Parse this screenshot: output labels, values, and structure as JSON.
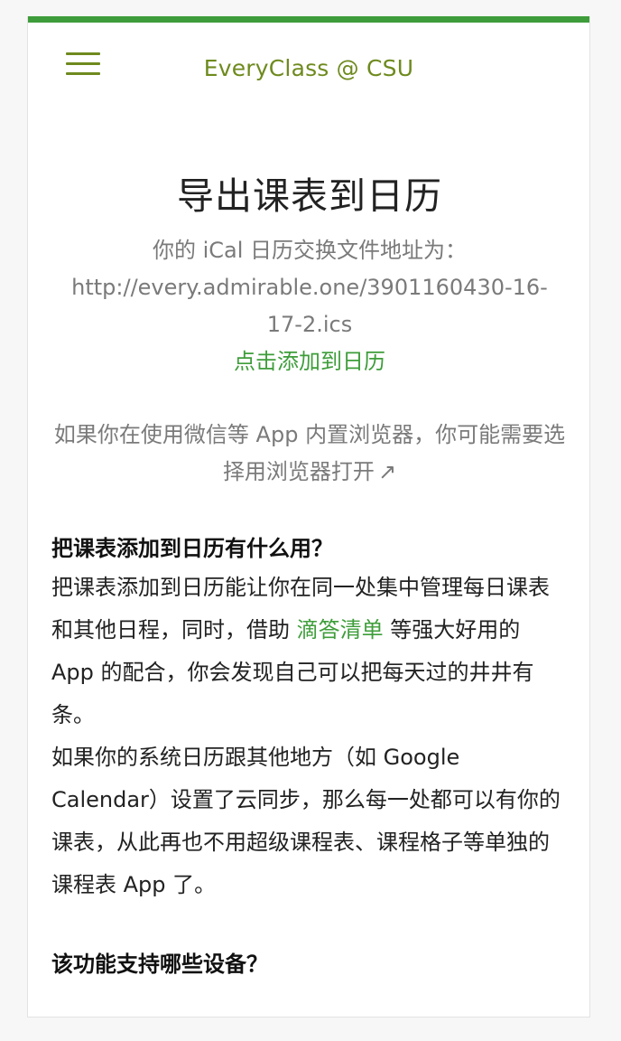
{
  "colors": {
    "accent": "#3e9d3a",
    "brand": "#6e8a1e",
    "muted_text": "#7a7a7a",
    "body_text": "#222222"
  },
  "navbar": {
    "menu_icon": "hamburger-menu-icon",
    "brand": "EveryClass @ CSU"
  },
  "export": {
    "title": "导出课表到日历",
    "address_label": "你的 iCal 日历交换文件地址为：",
    "ical_url": "http://every.admirable.one/3901160430-16-17-2.ics",
    "add_link": "点击添加到日历",
    "browser_note": "如果你在使用微信等 App 内置浏览器，你可能需要选择用浏览器打开",
    "browser_note_icon": "↗"
  },
  "faq": {
    "q1_title": "把课表添加到日历有什么用？",
    "q1_text_before": "把课表添加到日历能让你在同一处集中管理每日课表和其他日程，同时，借助 ",
    "q1_link": "滴答清单",
    "q1_text_after": " 等强大好用的 App 的配合，你会发现自己可以把每天过的井井有条。",
    "q1_text_2": "如果你的系统日历跟其他地方（如 Google Calendar）设置了云同步，那么每一处都可以有你的课表，从此再也不用超级课程表、课程格子等单独的课程表 App 了。",
    "q2_title": "该功能支持哪些设备？"
  }
}
